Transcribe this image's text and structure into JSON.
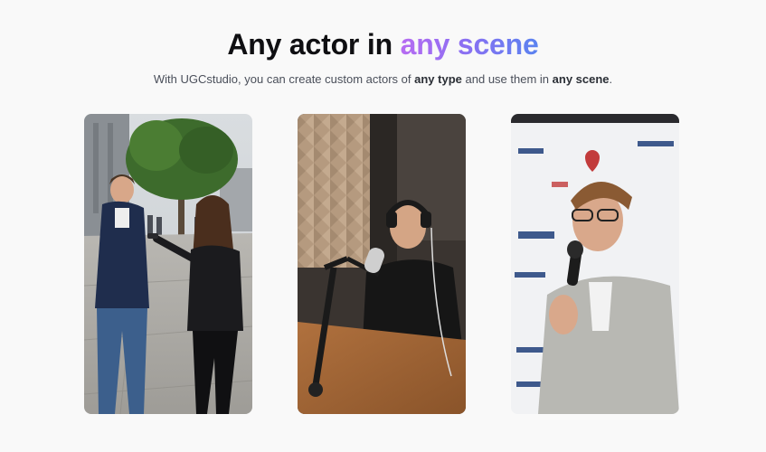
{
  "hero": {
    "title_plain": "Any actor in",
    "title_highlight": "any scene",
    "subtitle_prefix": "With UGCstudio, you can create custom actors of",
    "subtitle_bold_1": "any type",
    "subtitle_middle": "and use them in",
    "subtitle_bold_2": "any scene",
    "subtitle_suffix": "."
  },
  "cards": [
    {
      "scene": "street-interview"
    },
    {
      "scene": "podcast-studio"
    },
    {
      "scene": "conference-talk"
    }
  ],
  "colors": {
    "background": "#f9f9f9",
    "title": "#0f0f12",
    "gradient_start": "#b76cf2",
    "gradient_end": "#5a83f0",
    "subtitle": "#4a4f5a"
  }
}
